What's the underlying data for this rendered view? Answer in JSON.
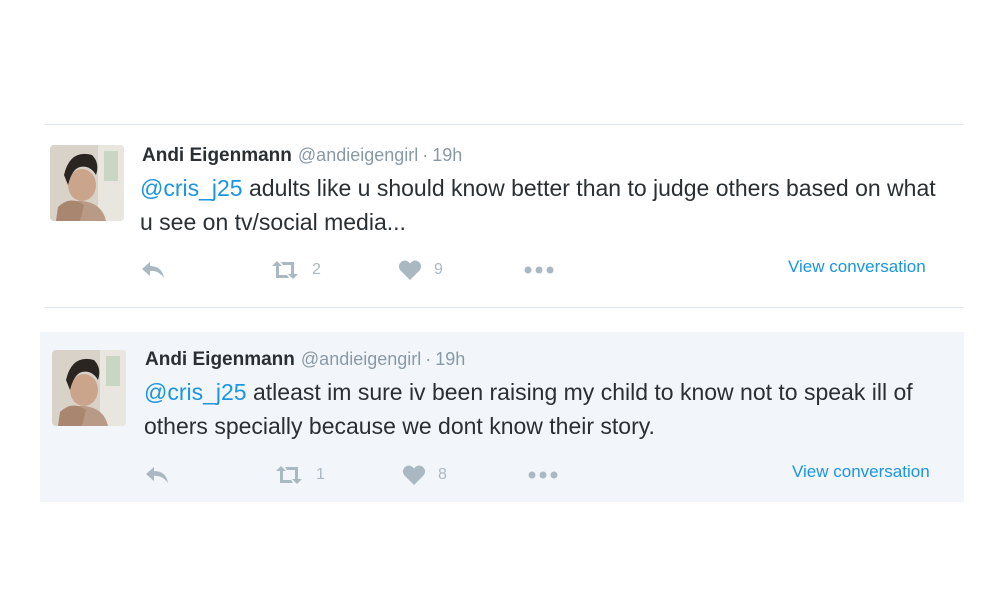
{
  "colors": {
    "link": "#1b95e0",
    "muted": "#8899a6",
    "text": "#292f33",
    "icon": "#aab8c2",
    "highlight_bg": "#f2f6fa"
  },
  "tweets": [
    {
      "name": "Andi Eigenmann",
      "handle": "@andieigengirl",
      "separator": "·",
      "time": "19h",
      "mention": "@cris_j25",
      "text": " adults like u should know better than to judge others based on what u see on tv/social media...",
      "retweet_count": "2",
      "like_count": "9",
      "view_conversation": "View conversation",
      "icons": [
        "reply-icon",
        "retweet-icon",
        "heart-icon",
        "more-icon"
      ]
    },
    {
      "name": "Andi Eigenmann",
      "handle": "@andieigengirl",
      "separator": "·",
      "time": "19h",
      "mention": "@cris_j25",
      "text": " atleast im sure iv been raising my child to know not to speak ill of others specially because we dont know their story.",
      "retweet_count": "1",
      "like_count": "8",
      "view_conversation": "View conversation",
      "icons": [
        "reply-icon",
        "retweet-icon",
        "heart-icon",
        "more-icon"
      ]
    }
  ]
}
